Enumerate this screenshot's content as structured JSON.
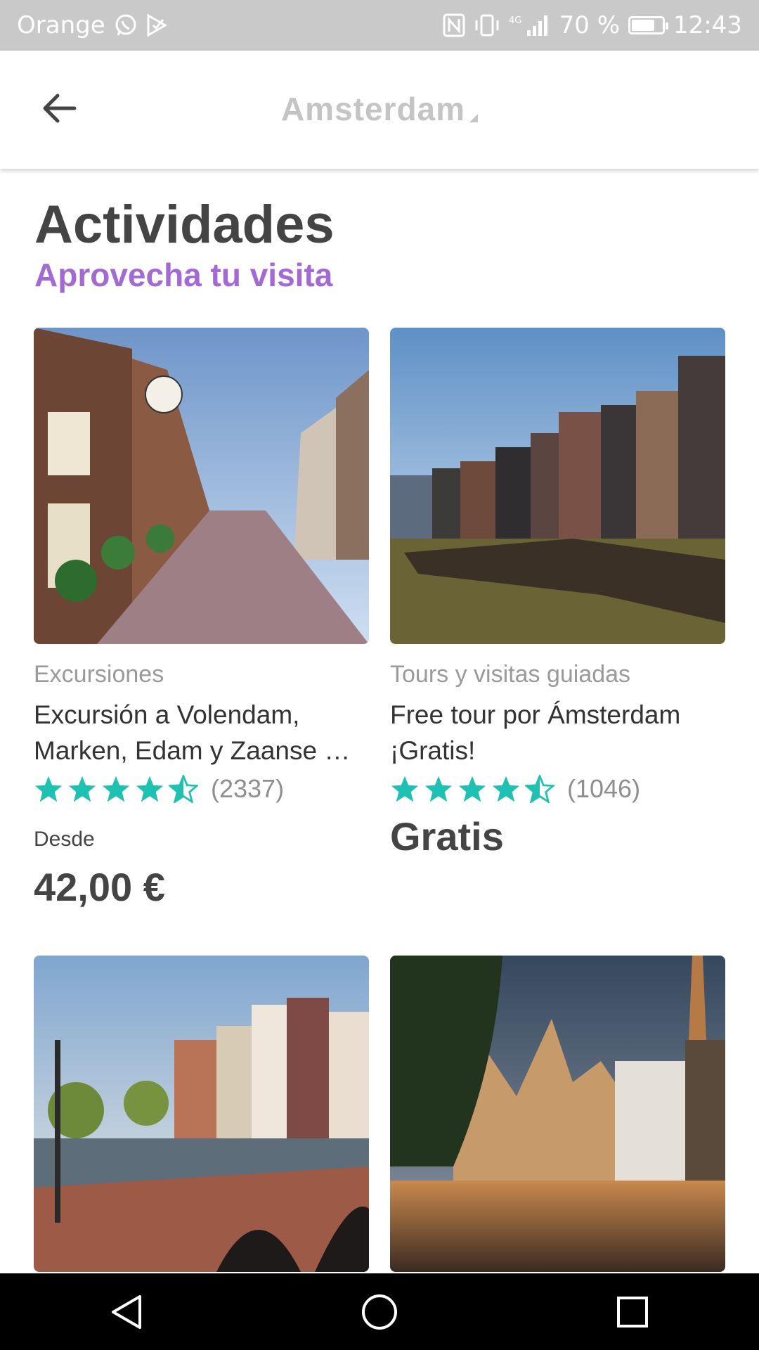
{
  "status_bar": {
    "carrier": "Orange",
    "network": "4G",
    "battery": "70 %",
    "time": "12:43",
    "icons": [
      "whatsapp-icon",
      "play-store-icon",
      "nfc-icon",
      "vibrate-icon",
      "signal-icon",
      "battery-icon"
    ]
  },
  "header": {
    "title": "Amsterdam",
    "back_icon": "arrow-left-icon"
  },
  "section": {
    "title": "Actividades",
    "subtitle": "Aprovecha tu visita",
    "subtitle_color": "#a36ad3"
  },
  "cards": [
    {
      "category": "Excursiones",
      "title": "Excursión a Volendam, Marken, Edam y Zaanse …",
      "rating": 4.5,
      "reviews": "(2337)",
      "price_label": "Desde",
      "price": "42,00 €"
    },
    {
      "category": "Tours y visitas guiadas",
      "title": "Free tour por Ámsterdam ¡Gratis!",
      "rating": 4.5,
      "reviews": "(1046)",
      "price": "Gratis"
    },
    {
      "category": "",
      "title": ""
    },
    {
      "category": "",
      "title": ""
    }
  ],
  "colors": {
    "star": "#1fc2b0",
    "text_dark": "#444444",
    "text_muted": "#9a9a9a"
  },
  "nav": {
    "icons": [
      "back-triangle-icon",
      "home-circle-icon",
      "recents-square-icon"
    ]
  }
}
